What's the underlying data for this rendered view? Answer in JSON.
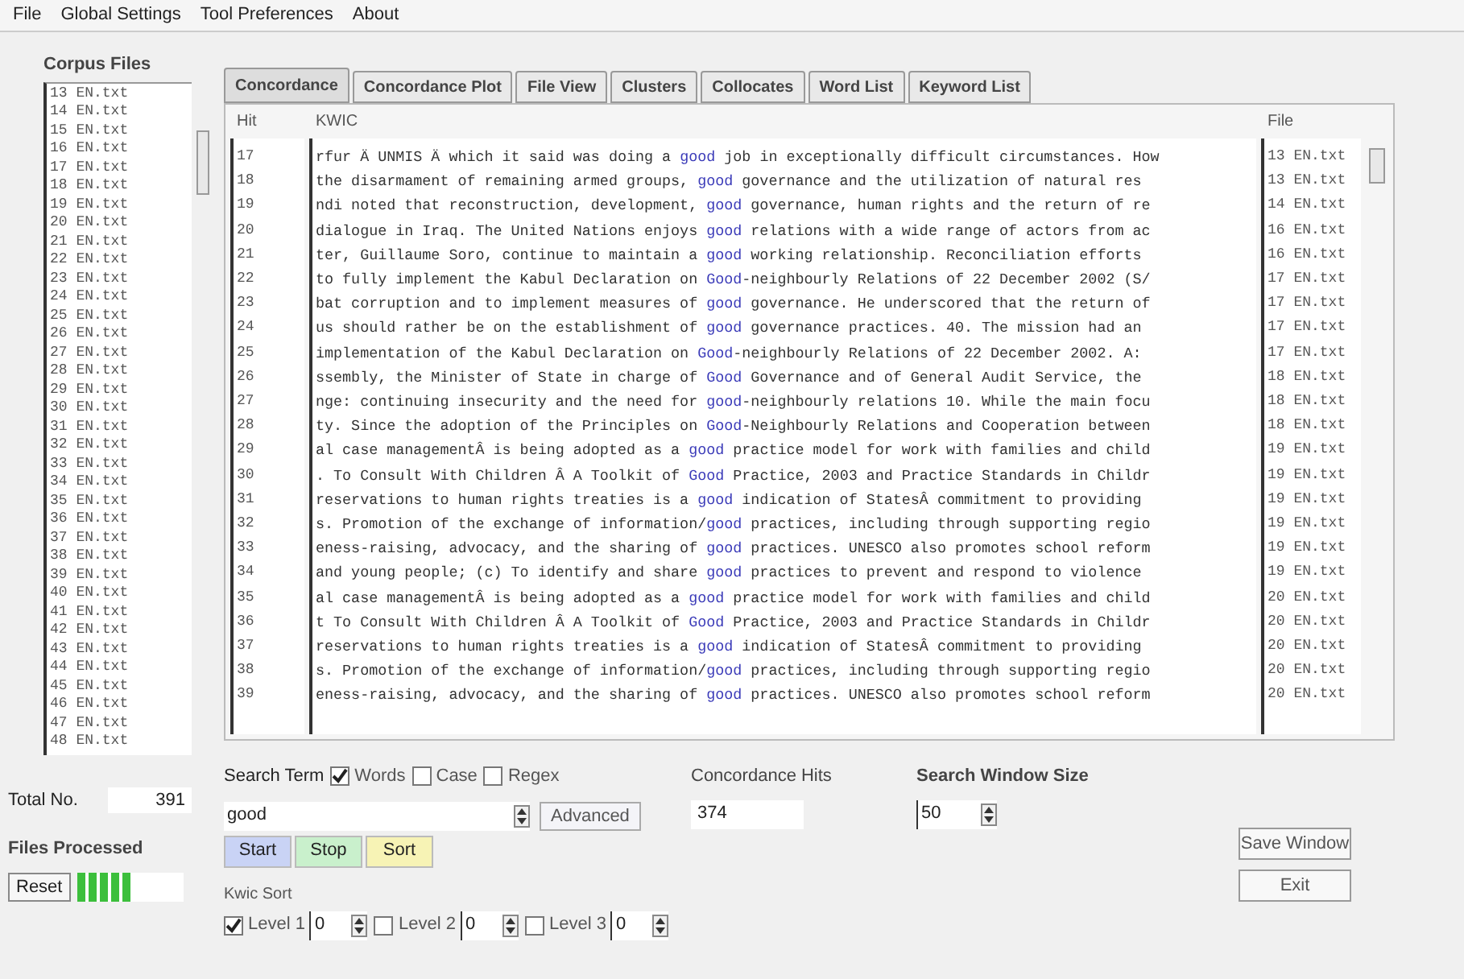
{
  "menu": [
    "File",
    "Global Settings",
    "Tool Preferences",
    "About"
  ],
  "corpus_files": {
    "label": "Corpus Files",
    "items": [
      "13 EN.txt",
      "14 EN.txt",
      "15 EN.txt",
      "16 EN.txt",
      "17 EN.txt",
      "18 EN.txt",
      "19 EN.txt",
      "20 EN.txt",
      "21 EN.txt",
      "22 EN.txt",
      "23 EN.txt",
      "24 EN.txt",
      "25 EN.txt",
      "26 EN.txt",
      "27 EN.txt",
      "28 EN.txt",
      "29 EN.txt",
      "30 EN.txt",
      "31 EN.txt",
      "32 EN.txt",
      "33 EN.txt",
      "34 EN.txt",
      "35 EN.txt",
      "36 EN.txt",
      "37 EN.txt",
      "38 EN.txt",
      "39 EN.txt",
      "40 EN.txt",
      "41 EN.txt",
      "42 EN.txt",
      "43 EN.txt",
      "44 EN.txt",
      "45 EN.txt",
      "46 EN.txt",
      "47 EN.txt",
      "48 EN.txt"
    ]
  },
  "total_no": {
    "label": "Total No.",
    "value": "391"
  },
  "files_processed": {
    "label": "Files Processed",
    "level": 0.5
  },
  "reset_button": "Reset",
  "tabs": [
    {
      "label": "Concordance",
      "selected": true
    },
    {
      "label": "Concordance Plot",
      "selected": false
    },
    {
      "label": "File View",
      "selected": false
    },
    {
      "label": "Clusters",
      "selected": false
    },
    {
      "label": "Collocates",
      "selected": false
    },
    {
      "label": "Word List",
      "selected": false
    },
    {
      "label": "Keyword List",
      "selected": false
    }
  ],
  "table": {
    "columns": [
      "Hit",
      "KWIC",
      "File"
    ],
    "rows": [
      {
        "hit": "17",
        "left": "rfur Ä UNMIS Ä which it said was doing a ",
        "key": "good",
        "right": " job in exceptionally difficult circumstances. How",
        "file": "13 EN.txt"
      },
      {
        "hit": "18",
        "left": " the disarmament of remaining armed groups, ",
        "key": "good",
        "right": " governance and the utilization of natural res",
        "file": "13 EN.txt"
      },
      {
        "hit": "19",
        "left": "ndi noted that reconstruction, development, ",
        "key": "good",
        "right": " governance, human rights and the return of re",
        "file": "14 EN.txt"
      },
      {
        "hit": "20",
        "left": "dialogue in Iraq. The United Nations enjoys ",
        "key": "good",
        "right": " relations with a wide range of actors from ac",
        "file": "16 EN.txt"
      },
      {
        "hit": "21",
        "left": "ter, Guillaume Soro, continue to maintain a ",
        "key": "good",
        "right": " working relationship. Reconciliation efforts",
        "file": "16 EN.txt"
      },
      {
        "hit": "22",
        "left": "to fully implement the Kabul Declaration on ",
        "key": "Good",
        "right": "-neighbourly Relations of 22 December 2002 (S/",
        "file": "17 EN.txt"
      },
      {
        "hit": "23",
        "left": "bat corruption and to implement measures of ",
        "key": "good",
        "right": " governance. He underscored that the return of",
        "file": "17 EN.txt"
      },
      {
        "hit": "24",
        "left": "us should rather be on the establishment of ",
        "key": "good",
        "right": " governance practices. 40. The mission had an",
        "file": "17 EN.txt"
      },
      {
        "hit": "25",
        "left": " implementation of the Kabul Declaration on ",
        "key": "Good",
        "right": "-neighbourly Relations of 22 December 2002. A:",
        "file": "17 EN.txt"
      },
      {
        "hit": "26",
        "left": "ssembly, the Minister of State in charge of ",
        "key": "Good",
        "right": " Governance and of General Audit Service, the",
        "file": "18 EN.txt"
      },
      {
        "hit": "27",
        "left": "nge: continuing insecurity and the need for ",
        "key": "good",
        "right": "-neighbourly relations 10. While the main focu",
        "file": "18 EN.txt"
      },
      {
        "hit": "28",
        "left": "ty. Since the adoption of the Principles on ",
        "key": "Good",
        "right": "-Neighbourly Relations and Cooperation between",
        "file": "18 EN.txt"
      },
      {
        "hit": "29",
        "left": "al case managementÂ is being adopted as a ",
        "key": "good",
        "right": " practice model for work with families and child",
        "file": "19 EN.txt"
      },
      {
        "hit": "30",
        "left": ". To Consult With Children Â A Toolkit of ",
        "key": "Good",
        "right": " Practice, 2003 and Practice Standards in Childr",
        "file": "19 EN.txt"
      },
      {
        "hit": "31",
        "left": " reservations to human rights treaties is a ",
        "key": "good",
        "right": " indication of StatesÂ commitment to providing",
        "file": "19 EN.txt"
      },
      {
        "hit": "32",
        "left": "s. Promotion of the exchange of information/",
        "key": "good",
        "right": " practices, including through supporting regio",
        "file": "19 EN.txt"
      },
      {
        "hit": "33",
        "left": "eness-raising, advocacy, and the sharing of ",
        "key": "good",
        "right": " practices. UNESCO also promotes school reform",
        "file": "19 EN.txt"
      },
      {
        "hit": "34",
        "left": "and young people; (c) To identify and share ",
        "key": "good",
        "right": " practices to prevent and respond to violence",
        "file": "19 EN.txt"
      },
      {
        "hit": "35",
        "left": "al case managementÂ is being adopted as a ",
        "key": "good",
        "right": " practice model for work with families and child",
        "file": "20 EN.txt"
      },
      {
        "hit": "36",
        "left": "t To Consult With Children Â A Toolkit of ",
        "key": "Good",
        "right": " Practice, 2003 and Practice Standards in Childr",
        "file": "20 EN.txt"
      },
      {
        "hit": "37",
        "left": " reservations to human rights treaties is a ",
        "key": "good",
        "right": " indication of StatesÂ commitment to providing",
        "file": "20 EN.txt"
      },
      {
        "hit": "38",
        "left": "s. Promotion of the exchange of information/",
        "key": "good",
        "right": " practices, including through supporting regio",
        "file": "20 EN.txt"
      },
      {
        "hit": "39",
        "left": "eness-raising, advocacy, and the sharing of ",
        "key": "good",
        "right": " practices. UNESCO also promotes school reform",
        "file": "20 EN.txt"
      }
    ]
  },
  "search": {
    "label": "Search Term",
    "options": [
      {
        "label": "Words",
        "checked": true
      },
      {
        "label": "Case",
        "checked": false
      },
      {
        "label": "Regex",
        "checked": false
      }
    ],
    "value": "good",
    "advanced_button": "Advanced"
  },
  "actions": [
    {
      "label": "Start",
      "color": "#c9d3f5"
    },
    {
      "label": "Stop",
      "color": "#c9f0cc"
    },
    {
      "label": "Sort",
      "color": "#f7f3b5"
    }
  ],
  "hits": {
    "label": "Concordance Hits",
    "value": "374"
  },
  "window_size": {
    "label": "Search Window Size",
    "value": "50"
  },
  "kwic_sort": {
    "label": "Kwic Sort",
    "levels": [
      {
        "label": "Level 1",
        "checked": true,
        "value": "0"
      },
      {
        "label": "Level 2",
        "checked": false,
        "value": "0"
      },
      {
        "label": "Level 3",
        "checked": false,
        "value": "0"
      }
    ]
  },
  "save_button": "Save Window",
  "exit_button": "Exit"
}
